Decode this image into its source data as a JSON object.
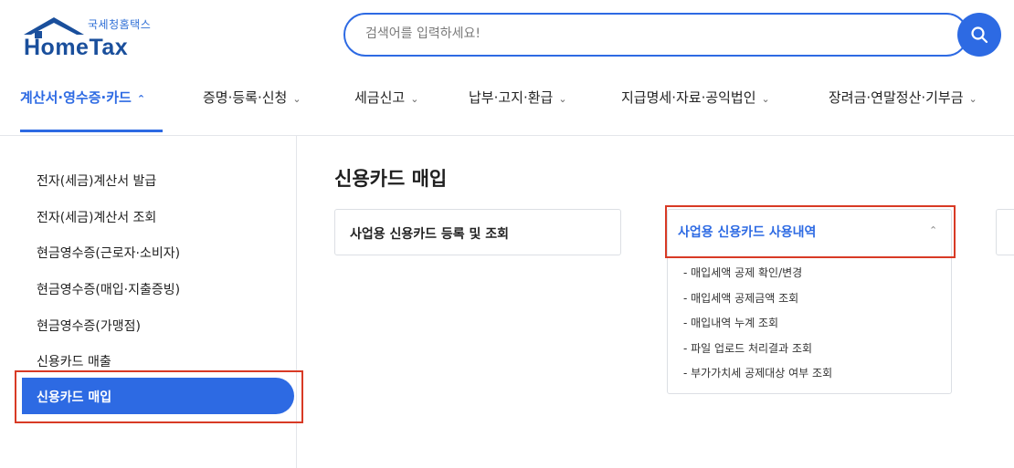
{
  "logo": {
    "sub": "국세청홈택스",
    "main": "HomeTax"
  },
  "search": {
    "placeholder": "검색어를 입력하세요!",
    "value": ""
  },
  "nav": {
    "items": [
      {
        "label": "계산서·영수증·카드",
        "chev": "⌃"
      },
      {
        "label": "증명·등록·신청",
        "chev": "⌄"
      },
      {
        "label": "세금신고",
        "chev": "⌄"
      },
      {
        "label": "납부·고지·환급",
        "chev": "⌄"
      },
      {
        "label": "지급명세·자료·공익법인",
        "chev": "⌄"
      },
      {
        "label": "장려금·연말정산·기부금",
        "chev": "⌄"
      }
    ]
  },
  "sidebar": {
    "items": [
      {
        "label": "전자(세금)계산서 발급"
      },
      {
        "label": "전자(세금)계산서 조회"
      },
      {
        "label": "현금영수증(근로자·소비자)"
      },
      {
        "label": "현금영수증(매입·지출증빙)"
      },
      {
        "label": "현금영수증(가맹점)"
      },
      {
        "label": "신용카드 매출"
      },
      {
        "label": "신용카드 매입"
      }
    ]
  },
  "main": {
    "title": "신용카드 매입",
    "card1": {
      "label": "사업용 신용카드 등록 및 조회"
    },
    "card2": {
      "label": "사업용 신용카드 사용내역",
      "chev": "⌃",
      "items": [
        {
          "label": "- 매입세액 공제 확인/변경"
        },
        {
          "label": "- 매입세액 공제금액 조회"
        },
        {
          "label": "- 매입내역 누계 조회"
        },
        {
          "label": "- 파일 업로드 처리결과 조회"
        },
        {
          "label": "- 부가가치세 공제대상 여부 조회"
        }
      ]
    }
  },
  "colors": {
    "accent": "#2d6ae3",
    "highlight": "#d83a25",
    "logo": "#1a4f9c"
  },
  "icons": {
    "search": "search-icon",
    "logo": "house-roof-icon"
  }
}
